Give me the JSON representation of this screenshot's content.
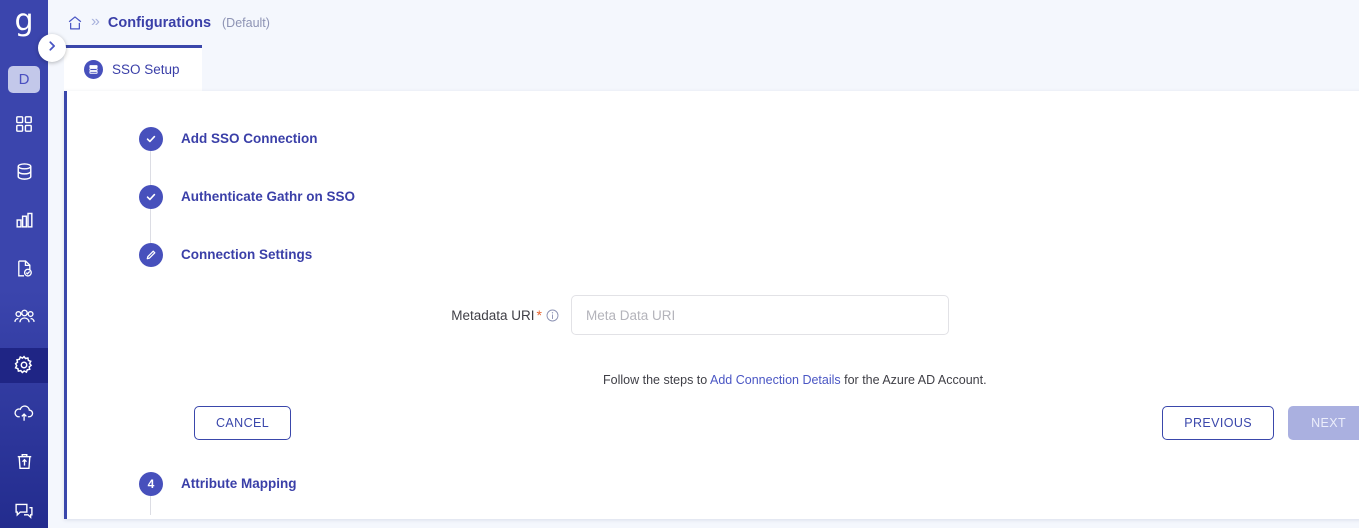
{
  "sidebar": {
    "logo": "g",
    "avatar_initial": "D",
    "items": [
      {
        "name": "dashboard-icon",
        "label": "Dashboard",
        "active": false
      },
      {
        "name": "database-icon",
        "label": "Data Sources",
        "active": false
      },
      {
        "name": "analytics-icon",
        "label": "Analytics",
        "active": false
      },
      {
        "name": "document-check-icon",
        "label": "Reports",
        "active": false
      },
      {
        "name": "users-icon",
        "label": "Users",
        "active": false
      },
      {
        "name": "gear-icon",
        "label": "Settings",
        "active": true
      },
      {
        "name": "cloud-upload-icon",
        "label": "Deployments",
        "active": false
      },
      {
        "name": "trash-upload-icon",
        "label": "Recycle Bin",
        "active": false
      },
      {
        "name": "chat-icon",
        "label": "Support",
        "active": false
      }
    ],
    "expand_handle": "chevron-right-icon"
  },
  "breadcrumb": {
    "home_icon": "home-icon",
    "separator": "»",
    "title": "Configurations",
    "subtitle": "(Default)"
  },
  "tabs": [
    {
      "label": "SSO Setup",
      "icon": "sso-stack-icon",
      "active": true
    }
  ],
  "panel": {
    "help_icon": "help-circle-icon"
  },
  "stepper": {
    "steps": [
      {
        "marker": "✓",
        "state": "complete",
        "title": "Add SSO Connection"
      },
      {
        "marker": "✓",
        "state": "complete",
        "title": "Authenticate Gathr on SSO"
      },
      {
        "marker": "✎",
        "state": "active",
        "title": "Connection Settings"
      },
      {
        "marker": "4",
        "state": "pending",
        "title": "Attribute Mapping"
      }
    ]
  },
  "form": {
    "metadata_uri": {
      "label": "Metadata URI",
      "required_mark": "*",
      "info_icon": "info-icon",
      "value": "",
      "placeholder": "Meta Data URI"
    },
    "hint_prefix": "Follow the steps to ",
    "hint_link": "Add Connection Details",
    "hint_suffix": " for the Azure AD Account."
  },
  "buttons": {
    "cancel": "CANCEL",
    "previous": "PREVIOUS",
    "next": "NEXT",
    "next_disabled": true
  },
  "colors": {
    "brand_blue": "#3a47ab",
    "rail_top": "#3b45ad",
    "rail_bottom": "#232c8e",
    "accent_text": "#3a3fa8",
    "link": "#4a56c4",
    "required": "#e8622c",
    "help_teal": "#1d9aa8",
    "disabled_btn": "#aab0e0",
    "page_bg": "#f4f7fd"
  }
}
